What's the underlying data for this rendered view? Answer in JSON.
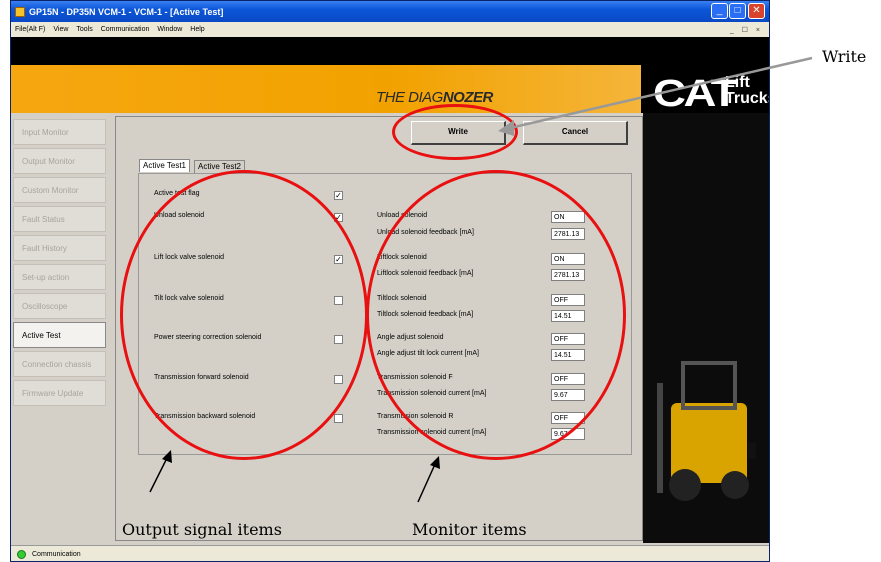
{
  "window": {
    "title": "GP15N - DP35N VCM-1 - VCM-1 - [Active Test]",
    "menu": [
      "File(Alt F)",
      "View",
      "Tools",
      "Communication",
      "Window",
      "Help"
    ],
    "mdi_controls": "_ ☐ ×"
  },
  "banner": {
    "product_prefix": "THE DIAG",
    "product_suffix": "NOZER",
    "brand": "CAT",
    "brand_sub_1": "Lift",
    "brand_sub_2": "Trucks"
  },
  "sidebar": {
    "items": [
      {
        "label": "Input Monitor",
        "active": false
      },
      {
        "label": "Output Monitor",
        "active": false
      },
      {
        "label": "Custom Monitor",
        "active": false
      },
      {
        "label": "Fault Status",
        "active": false
      },
      {
        "label": "Fault History",
        "active": false
      },
      {
        "label": "Set-up action",
        "active": false
      },
      {
        "label": "Oscilloscope",
        "active": false
      },
      {
        "label": "Active Test",
        "active": true
      },
      {
        "label": "Connection chassis",
        "active": false
      },
      {
        "label": "Firmware Update",
        "active": false
      }
    ]
  },
  "buttons": {
    "write": "Write",
    "cancel": "Cancel"
  },
  "tabs": [
    "Active Test1",
    "Active Test2"
  ],
  "outputs": [
    {
      "label": "Active test flag",
      "checked": true
    },
    {
      "label": "Unload solenoid",
      "checked": true
    },
    {
      "label": "Lift lock valve solenoid",
      "checked": true
    },
    {
      "label": "Tilt lock valve solenoid",
      "checked": false
    },
    {
      "label": "Power steering correction solenoid",
      "checked": false
    },
    {
      "label": "Transmission forward solenoid",
      "checked": false
    },
    {
      "label": "Transmission backward solenoid",
      "checked": false
    }
  ],
  "monitors": [
    {
      "label": "Unload solenoid",
      "value": "ON"
    },
    {
      "label": "Unload solenoid feedback [mA]",
      "value": "2781.13"
    },
    {
      "label": "Liftlock solenoid",
      "value": "ON"
    },
    {
      "label": "Liftlock solenoid feedback [mA]",
      "value": "2781.13"
    },
    {
      "label": "Tiltlock solenoid",
      "value": "OFF"
    },
    {
      "label": "Tiltlock solenoid feedback [mA]",
      "value": "14.51"
    },
    {
      "label": "Angle adjust solenoid",
      "value": "OFF"
    },
    {
      "label": "Angle adjust tilt lock current [mA]",
      "value": "14.51"
    },
    {
      "label": "Transmission solenoid F",
      "value": "OFF"
    },
    {
      "label": "Transmission solenoid current [mA]",
      "value": "9.67"
    },
    {
      "label": "Transmission solenoid R",
      "value": "OFF"
    },
    {
      "label": "Transmission solenoid current [mA]",
      "value": "9.67"
    }
  ],
  "status": {
    "text": "Communication"
  },
  "annotations": {
    "write": "Write",
    "outputs": "Output signal items",
    "monitors": "Monitor items"
  },
  "colors": {
    "accent": "#f2a200",
    "highlight": "#e81010",
    "status_led": "#33cc33"
  }
}
